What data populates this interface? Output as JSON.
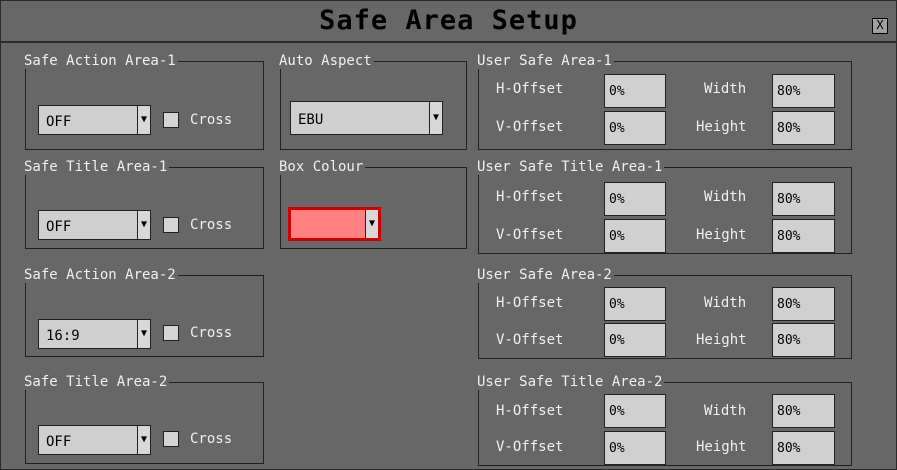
{
  "window": {
    "title": "Safe Area Setup",
    "close_label": "X"
  },
  "left_groups": [
    {
      "legend": "Safe Action Area-1",
      "value": "OFF",
      "cross_label": "Cross"
    },
    {
      "legend": "Safe Title Area-1",
      "value": "OFF",
      "cross_label": "Cross"
    },
    {
      "legend": "Safe Action Area-2",
      "value": "16:9",
      "cross_label": "Cross"
    },
    {
      "legend": "Safe Title Area-2",
      "value": "OFF",
      "cross_label": "Cross"
    }
  ],
  "auto_aspect": {
    "legend": "Auto Aspect",
    "value": "EBU"
  },
  "box_colour": {
    "legend": "Box Colour",
    "color": "#ff8080"
  },
  "labels": {
    "h_offset": "H-Offset",
    "v_offset": "V-Offset",
    "width": "Width",
    "height": "Height"
  },
  "user_groups": [
    {
      "legend": "User Safe Area-1",
      "h_offset": "0%",
      "v_offset": "0%",
      "width": "80%",
      "height": "80%"
    },
    {
      "legend": "User Safe Title Area-1",
      "h_offset": "0%",
      "v_offset": "0%",
      "width": "80%",
      "height": "80%"
    },
    {
      "legend": "User Safe Area-2",
      "h_offset": "0%",
      "v_offset": "0%",
      "width": "80%",
      "height": "80%"
    },
    {
      "legend": "User Safe Title Area-2",
      "h_offset": "0%",
      "v_offset": "0%",
      "width": "80%",
      "height": "80%"
    }
  ]
}
